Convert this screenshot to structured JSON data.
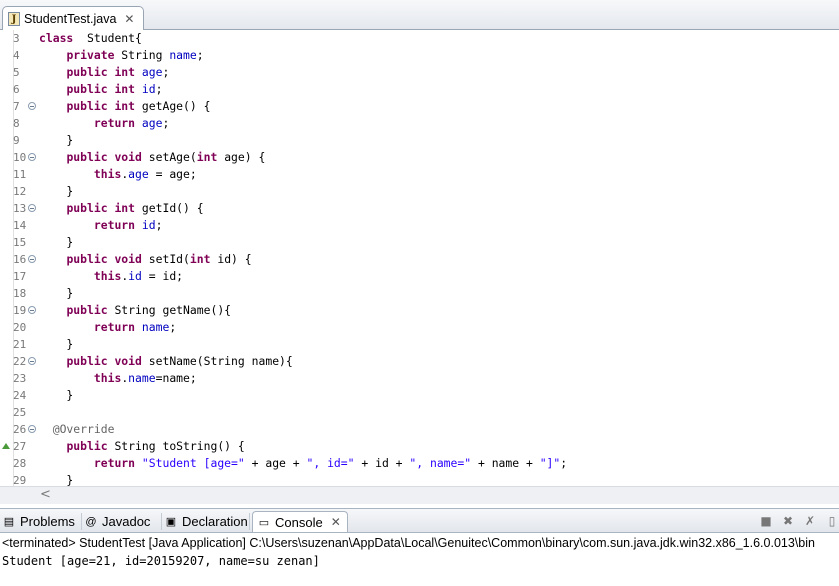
{
  "editor_tab": {
    "label": "StudentTest.java",
    "icon": "java-file-icon",
    "close": "✕"
  },
  "code_lines": [
    {
      "n": "3",
      "fold": false,
      "marker": false,
      "parts": [
        [
          "kw",
          "class"
        ],
        [
          "",
          "  Student{"
        ]
      ]
    },
    {
      "n": "4",
      "fold": false,
      "marker": false,
      "parts": [
        [
          "",
          "    "
        ],
        [
          "kw",
          "private"
        ],
        [
          "",
          " String "
        ],
        [
          "fld",
          "name"
        ],
        [
          "",
          ";"
        ]
      ]
    },
    {
      "n": "5",
      "fold": false,
      "marker": false,
      "parts": [
        [
          "",
          "    "
        ],
        [
          "kw",
          "public"
        ],
        [
          "",
          " "
        ],
        [
          "kw",
          "int"
        ],
        [
          "",
          " "
        ],
        [
          "fld",
          "age"
        ],
        [
          "",
          ";"
        ]
      ]
    },
    {
      "n": "6",
      "fold": false,
      "marker": false,
      "parts": [
        [
          "",
          "    "
        ],
        [
          "kw",
          "public"
        ],
        [
          "",
          " "
        ],
        [
          "kw",
          "int"
        ],
        [
          "",
          " "
        ],
        [
          "fld",
          "id"
        ],
        [
          "",
          ";"
        ]
      ]
    },
    {
      "n": "7",
      "fold": true,
      "marker": false,
      "parts": [
        [
          "",
          "    "
        ],
        [
          "kw",
          "public"
        ],
        [
          "",
          " "
        ],
        [
          "kw",
          "int"
        ],
        [
          "",
          " getAge() {"
        ]
      ]
    },
    {
      "n": "8",
      "fold": false,
      "marker": false,
      "parts": [
        [
          "",
          "        "
        ],
        [
          "kw",
          "return"
        ],
        [
          "",
          " "
        ],
        [
          "fld",
          "age"
        ],
        [
          "",
          ";"
        ]
      ]
    },
    {
      "n": "9",
      "fold": false,
      "marker": false,
      "parts": [
        [
          "",
          "    }"
        ]
      ]
    },
    {
      "n": "10",
      "fold": true,
      "marker": false,
      "parts": [
        [
          "",
          "    "
        ],
        [
          "kw",
          "public"
        ],
        [
          "",
          " "
        ],
        [
          "kw",
          "void"
        ],
        [
          "",
          " setAge("
        ],
        [
          "kw",
          "int"
        ],
        [
          "",
          " age) {"
        ]
      ]
    },
    {
      "n": "11",
      "fold": false,
      "marker": false,
      "parts": [
        [
          "",
          "        "
        ],
        [
          "kw",
          "this"
        ],
        [
          "",
          "."
        ],
        [
          "fld",
          "age"
        ],
        [
          "",
          " = age;"
        ]
      ]
    },
    {
      "n": "12",
      "fold": false,
      "marker": false,
      "parts": [
        [
          "",
          "    }"
        ]
      ]
    },
    {
      "n": "13",
      "fold": true,
      "marker": false,
      "parts": [
        [
          "",
          "    "
        ],
        [
          "kw",
          "public"
        ],
        [
          "",
          " "
        ],
        [
          "kw",
          "int"
        ],
        [
          "",
          " getId() {"
        ]
      ]
    },
    {
      "n": "14",
      "fold": false,
      "marker": false,
      "parts": [
        [
          "",
          "        "
        ],
        [
          "kw",
          "return"
        ],
        [
          "",
          " "
        ],
        [
          "fld",
          "id"
        ],
        [
          "",
          ";"
        ]
      ]
    },
    {
      "n": "15",
      "fold": false,
      "marker": false,
      "parts": [
        [
          "",
          "    }"
        ]
      ]
    },
    {
      "n": "16",
      "fold": true,
      "marker": false,
      "parts": [
        [
          "",
          "    "
        ],
        [
          "kw",
          "public"
        ],
        [
          "",
          " "
        ],
        [
          "kw",
          "void"
        ],
        [
          "",
          " setId("
        ],
        [
          "kw",
          "int"
        ],
        [
          "",
          " id) {"
        ]
      ]
    },
    {
      "n": "17",
      "fold": false,
      "marker": false,
      "parts": [
        [
          "",
          "        "
        ],
        [
          "kw",
          "this"
        ],
        [
          "",
          "."
        ],
        [
          "fld",
          "id"
        ],
        [
          "",
          " = id;"
        ]
      ]
    },
    {
      "n": "18",
      "fold": false,
      "marker": false,
      "parts": [
        [
          "",
          "    }"
        ]
      ]
    },
    {
      "n": "19",
      "fold": true,
      "marker": false,
      "parts": [
        [
          "",
          "    "
        ],
        [
          "kw",
          "public"
        ],
        [
          "",
          " String getName(){"
        ]
      ]
    },
    {
      "n": "20",
      "fold": false,
      "marker": false,
      "parts": [
        [
          "",
          "        "
        ],
        [
          "kw",
          "return"
        ],
        [
          "",
          " "
        ],
        [
          "fld",
          "name"
        ],
        [
          "",
          ";"
        ]
      ]
    },
    {
      "n": "21",
      "fold": false,
      "marker": false,
      "parts": [
        [
          "",
          "    }"
        ]
      ]
    },
    {
      "n": "22",
      "fold": true,
      "marker": false,
      "parts": [
        [
          "",
          "    "
        ],
        [
          "kw",
          "public"
        ],
        [
          "",
          " "
        ],
        [
          "kw",
          "void"
        ],
        [
          "",
          " setName(String name){"
        ]
      ]
    },
    {
      "n": "23",
      "fold": false,
      "marker": false,
      "parts": [
        [
          "",
          "        "
        ],
        [
          "kw",
          "this"
        ],
        [
          "",
          "."
        ],
        [
          "fld",
          "name"
        ],
        [
          "",
          "=name;"
        ]
      ]
    },
    {
      "n": "24",
      "fold": false,
      "marker": false,
      "parts": [
        [
          "",
          "    }"
        ]
      ]
    },
    {
      "n": "25",
      "fold": false,
      "marker": false,
      "parts": []
    },
    {
      "n": "26",
      "fold": true,
      "marker": false,
      "parts": [
        [
          "",
          "  "
        ],
        [
          "ann",
          "@Override"
        ]
      ]
    },
    {
      "n": "27",
      "fold": false,
      "marker": true,
      "parts": [
        [
          "",
          "    "
        ],
        [
          "kw",
          "public"
        ],
        [
          "",
          " String toString() {"
        ]
      ]
    },
    {
      "n": "28",
      "fold": false,
      "marker": false,
      "parts": [
        [
          "",
          "        "
        ],
        [
          "kw",
          "return"
        ],
        [
          "",
          " "
        ],
        [
          "str",
          "\"Student [age=\""
        ],
        [
          "",
          " + age + "
        ],
        [
          "str",
          "\", id=\""
        ],
        [
          "",
          " + id + "
        ],
        [
          "str",
          "\", name=\""
        ],
        [
          "",
          " + name + "
        ],
        [
          "str",
          "\"]\""
        ],
        [
          "",
          ";"
        ]
      ]
    },
    {
      "n": "29",
      "fold": false,
      "marker": false,
      "parts": [
        [
          "",
          "    }"
        ]
      ]
    }
  ],
  "scrollbar": {
    "left_arrow": "<"
  },
  "view_tabs": [
    {
      "label": "Problems",
      "icon": "problems-icon",
      "glyph": "▤",
      "active": false
    },
    {
      "label": "Javadoc",
      "icon": "javadoc-icon",
      "glyph": "@",
      "active": false
    },
    {
      "label": "Declaration",
      "icon": "declaration-icon",
      "glyph": "▣",
      "active": false
    },
    {
      "label": "Console",
      "icon": "console-icon",
      "glyph": "▭",
      "active": true
    }
  ],
  "console_close": "✕",
  "console_toolbar": [
    {
      "name": "terminate-icon",
      "glyph": "■"
    },
    {
      "name": "remove-launch-icon",
      "glyph": "✖"
    },
    {
      "name": "remove-all-launches-icon",
      "glyph": "✗"
    },
    {
      "name": "clear-console-icon",
      "glyph": "▯"
    }
  ],
  "console": {
    "header": "<terminated> StudentTest [Java Application] C:\\Users\\suzenan\\AppData\\Local\\Genuitec\\Common\\binary\\com.sun.java.jdk.win32.x86_1.6.0.013\\bin",
    "output": "Student [age=21, id=20159207, name=su zenan]"
  }
}
